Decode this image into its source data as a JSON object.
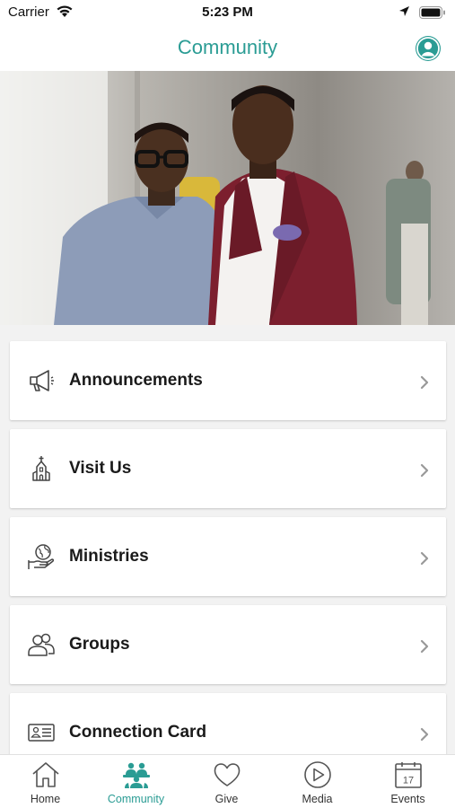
{
  "status_bar": {
    "carrier": "Carrier",
    "time": "5:23 PM"
  },
  "nav": {
    "title": "Community"
  },
  "colors": {
    "accent": "#2a9c94",
    "text": "#1a1a1a",
    "icon": "#444444"
  },
  "menu": {
    "items": [
      {
        "label": "Announcements",
        "icon": "megaphone-icon"
      },
      {
        "label": "Visit Us",
        "icon": "church-icon"
      },
      {
        "label": "Ministries",
        "icon": "globe-hand-icon"
      },
      {
        "label": "Groups",
        "icon": "people-icon"
      },
      {
        "label": "Connection Card",
        "icon": "id-card-icon"
      }
    ]
  },
  "tabs": [
    {
      "label": "Home",
      "icon": "home-icon",
      "active": false
    },
    {
      "label": "Community",
      "icon": "community-icon",
      "active": true
    },
    {
      "label": "Give",
      "icon": "heart-icon",
      "active": false
    },
    {
      "label": "Media",
      "icon": "play-circle-icon",
      "active": false
    },
    {
      "label": "Events",
      "icon": "calendar-icon",
      "active": false,
      "day": "17"
    }
  ]
}
